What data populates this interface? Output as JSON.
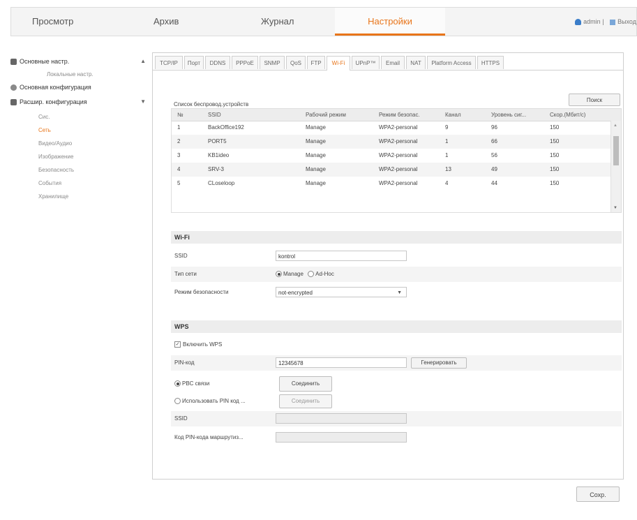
{
  "topnav": {
    "tabs": [
      {
        "label": "Просмотр"
      },
      {
        "label": "Архив"
      },
      {
        "label": "Журнал"
      },
      {
        "label": "Настройки"
      }
    ],
    "user": "admin",
    "separator": "|",
    "logout": "Выход"
  },
  "sidebar": {
    "sections": [
      {
        "label": "Основные настр.",
        "sub": [
          "Локальные настр."
        ]
      },
      {
        "label": "Основная конфигурация"
      },
      {
        "label": "Расшир. конфигурация",
        "sub": [
          "Сис.",
          "Сеть",
          "Видео/Аудио",
          "Изображение",
          "Безопасность",
          "События",
          "Хранилище"
        ]
      }
    ]
  },
  "tabs": [
    "TCP/IP",
    "Порт",
    "DDNS",
    "PPPoE",
    "SNMP",
    "QoS",
    "FTP",
    "Wi-Fi",
    "UPnP™",
    "Email",
    "NAT",
    "Platform Access",
    "HTTPS"
  ],
  "wifi_list": {
    "title": "Список беспровод.устройств",
    "search_label": "Поиск",
    "columns": [
      "№",
      "SSID",
      "Рабочий режим",
      "Режим безопас.",
      "Канал",
      "Уровень сиг...",
      "Скор.(Мбит/с)"
    ],
    "rows": [
      [
        "1",
        "BackOffice192",
        "Manage",
        "WPA2-personal",
        "9",
        "96",
        "150"
      ],
      [
        "2",
        "PORT5",
        "Manage",
        "WPA2-personal",
        "1",
        "66",
        "150"
      ],
      [
        "3",
        "KB1ideo",
        "Manage",
        "WPA2-personal",
        "1",
        "56",
        "150"
      ],
      [
        "4",
        "SRV-3",
        "Manage",
        "WPA2-personal",
        "13",
        "49",
        "150"
      ],
      [
        "5",
        "CLoseloop",
        "Manage",
        "WPA2-personal",
        "4",
        "44",
        "150"
      ]
    ]
  },
  "wifi": {
    "heading": "Wi-Fi",
    "ssid_label": "SSID",
    "ssid_value": "kontrol",
    "network_type_label": "Тип сети",
    "mode_manage": "Manage",
    "mode_adhoc": "Ad-Hoc",
    "security_label": "Режим безопасности",
    "security_value": "not-encrypted"
  },
  "wps": {
    "heading": "WPS",
    "enable_label": "Включить WPS",
    "pin_label": "PIN-код",
    "pin_value": "12345678",
    "generate_label": "Генерировать",
    "pbc_label": "PBC связи",
    "connect_label": "Соединить",
    "use_pin_label": "Использовать PIN код ...",
    "connect_label_2": "Соединить",
    "ssid_label": "SSID",
    "router_pin_label": "Код PIN-кода маршрутиз..."
  },
  "save_label": "Сохр."
}
